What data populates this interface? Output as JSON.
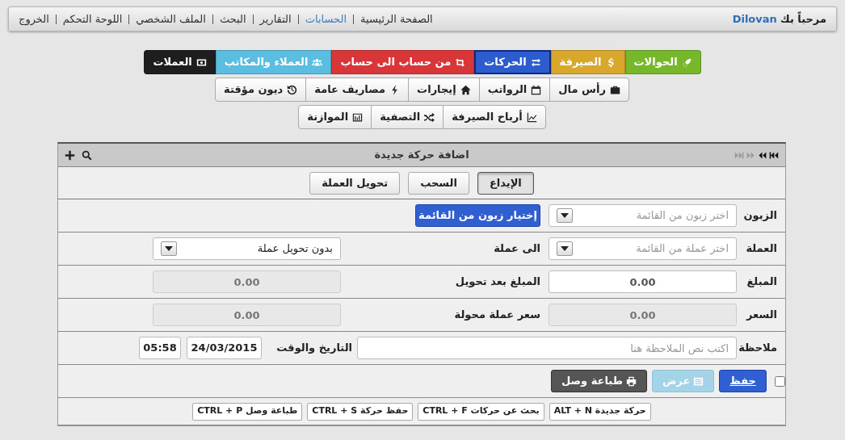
{
  "header": {
    "greeting": "مرحباً بك",
    "user": "Dilovan",
    "nav": [
      {
        "label": "الصفحة الرئيسية",
        "selected": false
      },
      {
        "label": "الحسابات",
        "selected": true
      },
      {
        "label": "التقارير",
        "selected": false
      },
      {
        "label": "البحث",
        "selected": false
      },
      {
        "label": "الملف الشخصي",
        "selected": false
      },
      {
        "label": "اللوحة التحكم",
        "selected": false
      },
      {
        "label": "الخروج",
        "selected": false
      }
    ]
  },
  "main_menu": [
    [
      {
        "label": "الحوالات",
        "color": "#76b82a",
        "selected": false
      },
      {
        "label": "الصيرفة",
        "color": "#d9a72b",
        "selected": false
      },
      {
        "label": "الحركات",
        "color": "#2d5ccf",
        "selected": true
      },
      {
        "label": "من حساب الى حساب",
        "color": "#d9363a",
        "selected": false
      },
      {
        "label": "العملاء والمكاتب",
        "color": "#5bbde0",
        "selected": false
      },
      {
        "label": "العملات",
        "color": "#1e1e1e",
        "selected": false
      }
    ],
    [
      {
        "label": "رأس مال"
      },
      {
        "label": "الرواتب"
      },
      {
        "label": "إيجارات"
      },
      {
        "label": "مصاريف عامة"
      },
      {
        "label": "ديون مؤقتة"
      }
    ],
    [
      {
        "label": "أرباح الصيرفة"
      },
      {
        "label": "التصفية"
      },
      {
        "label": "الموازنة"
      }
    ]
  ],
  "panel": {
    "title": "اضافة حركة جديدة",
    "pager": [
      {
        "kind": "first",
        "disabled": false
      },
      {
        "kind": "prev",
        "disabled": false
      },
      {
        "kind": "next",
        "disabled": true
      },
      {
        "kind": "last",
        "disabled": true
      }
    ],
    "types": [
      {
        "label": "الإيداع",
        "selected": true
      },
      {
        "label": "السحب",
        "selected": false
      },
      {
        "label": "تحويل العملة",
        "selected": false
      }
    ],
    "rows": [
      {
        "kind": "customer",
        "label": "الزبون",
        "field": {
          "kind": "select",
          "placeholder": "اختر زبون من القائمة"
        },
        "button": "إختيار زبون من القائمة"
      },
      {
        "kind": "pair",
        "label": "العملة",
        "field": {
          "kind": "select",
          "placeholder": "اختر عملة من القائمة"
        },
        "label2": "الى عملة",
        "field2": {
          "kind": "select",
          "value": "بدون تحويل عملة"
        }
      },
      {
        "kind": "pair",
        "label": "المبلغ",
        "field": {
          "kind": "input",
          "value": "0.00",
          "disabled": false
        },
        "label2": "المبلغ بعد تحويل",
        "field2": {
          "kind": "input",
          "value": "0.00",
          "disabled": true
        }
      },
      {
        "kind": "pair",
        "label": "السعر",
        "field": {
          "kind": "input",
          "value": "0.00",
          "disabled": true
        },
        "label2": "سعر عملة محولة",
        "field2": {
          "kind": "input",
          "value": "0.00",
          "disabled": true
        }
      },
      {
        "kind": "note",
        "label": "ملاحظة",
        "field": {
          "kind": "input",
          "placeholder": "اكتب نص الملاحظة هنا"
        },
        "label2": "التاريخ والوقت",
        "date": "24/03/2015",
        "time": "05:58"
      }
    ],
    "actions": {
      "checked": false,
      "buttons": [
        {
          "label": "حفظ",
          "kind": "save",
          "disabled": false
        },
        {
          "label": "عرض",
          "kind": "view",
          "disabled": true
        },
        {
          "label": "طباعة وصل",
          "kind": "print",
          "disabled": false
        }
      ]
    },
    "shortcuts": [
      "ALT + N حركة جديدة",
      "CTRL + F بحث عن حركات",
      "CTRL + S حفظ حركة",
      "CTRL + P طباعة وصل"
    ]
  }
}
